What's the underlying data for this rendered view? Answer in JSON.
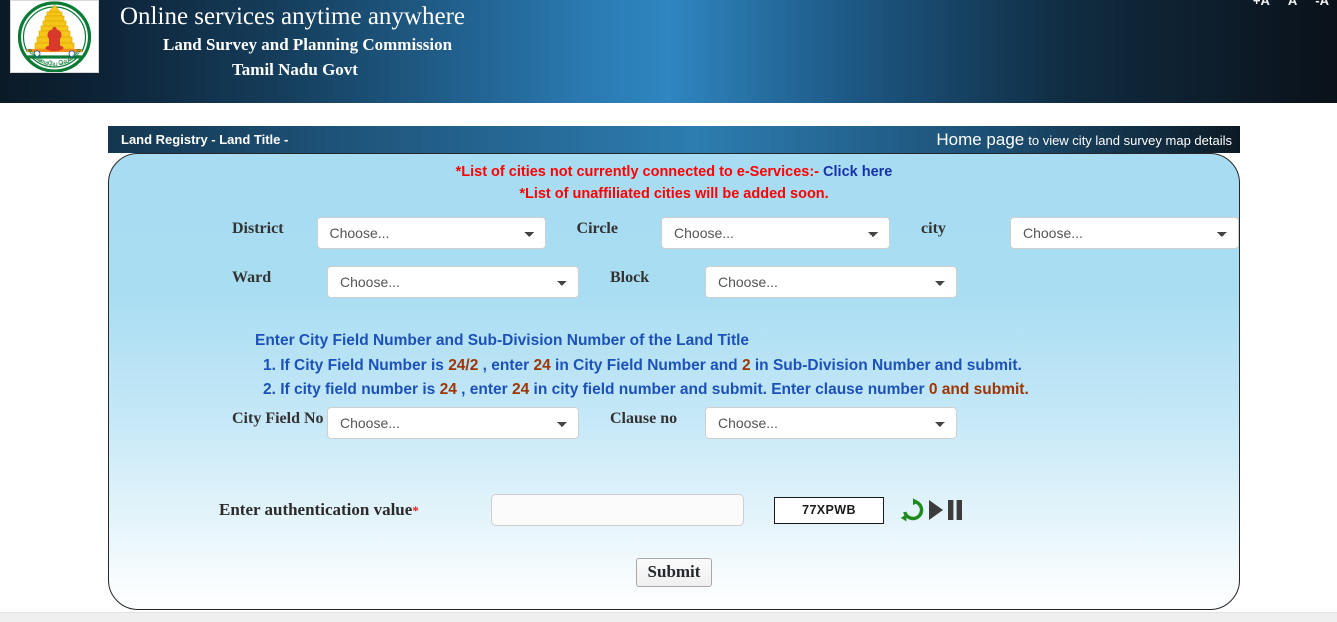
{
  "header": {
    "main_title": "Online services anytime anywhere",
    "sub_title_1": "Land Survey and Planning Commission",
    "sub_title_2": "Tamil Nadu Govt",
    "logo_name": "tamil-nadu-state-emblem",
    "font_controls": [
      {
        "label": "+A",
        "name": "increase-font-size"
      },
      {
        "label": "A",
        "name": "reset-font-size"
      },
      {
        "label": "-A",
        "name": "decrease-font-size"
      }
    ]
  },
  "registry_bar": {
    "title": "Land Registry - Land Title -",
    "home_page_label": "Home page",
    "home_page_desc": "to view city land survey map details"
  },
  "notices": {
    "line1_red": "*List of cities not currently connected to e-Services:-",
    "line1_link": "Click here",
    "line2": "*List of unaffiliated cities will be added soon.",
    "red_color": "#fe0000",
    "link_color": "#1632a8"
  },
  "form": {
    "placeholder": "Choose...",
    "fields": {
      "district": "District",
      "circle": "Circle",
      "city": "city",
      "ward": "Ward",
      "block": "Block",
      "city_field_no": "City Field No",
      "clause_no": "Clause no"
    }
  },
  "instructions": {
    "heading": "Enter City Field Number and Sub-Division Number of the Land Title",
    "line1": {
      "a": "1. If City Field Number is ",
      "n1": "24/2",
      "b": " , enter ",
      "n2": "24",
      "c": " in City Field Number and ",
      "n3": "2",
      "d": " in Sub-Division Number and submit."
    },
    "line2": {
      "a": "2. If city field number is ",
      "n1": "24",
      "b": " , enter ",
      "n2": "24",
      "c": " in city field number and submit. Enter clause number ",
      "tail": "0 and submit."
    },
    "text_color": "#1c52b8",
    "number_color": "#9d3605"
  },
  "captcha": {
    "label": "Enter authentication value",
    "required_mark": "*",
    "input_value": "",
    "input_placeholder": "",
    "code": "77XPWB",
    "refresh_icon": "refresh-icon",
    "play_icon": "play-icon",
    "pause_icon": "pause-icon",
    "refresh_color": "#1d8a1d",
    "media_color": "#3c3c3c"
  },
  "submit": {
    "label": "Submit"
  }
}
